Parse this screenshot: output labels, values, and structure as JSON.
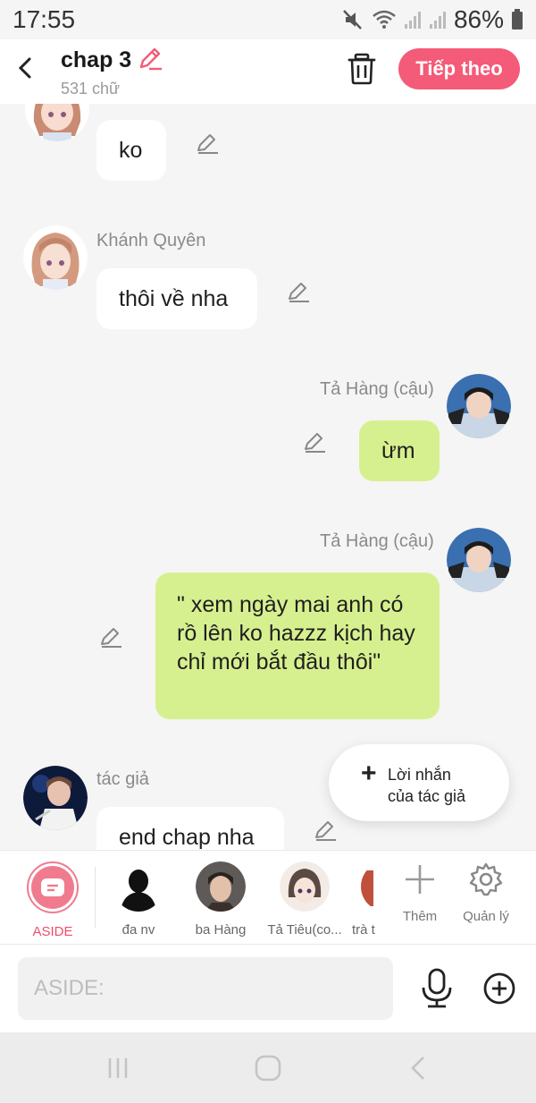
{
  "status_bar": {
    "time": "17:55",
    "battery": "86%"
  },
  "header": {
    "title": "chap 3",
    "subtitle": "531 chữ",
    "next_label": "Tiếp theo"
  },
  "messages": [
    {
      "text": "ko"
    },
    {
      "sender": "Khánh Quyên",
      "text": "thôi về nha"
    },
    {
      "sender": "Tả Hàng (cậu)",
      "text": "ừm"
    },
    {
      "sender": "Tả Hàng (cậu)",
      "text": "\" xem ngày mai anh có rồ lên ko hazzz kịch hay chỉ mới bắt đầu thôi\""
    },
    {
      "sender": "tác giả",
      "text": "end chap nha"
    }
  ],
  "author_note": {
    "line1": "Lời nhắn",
    "line2": "của tác giả"
  },
  "characters": [
    {
      "label": "ASIDE",
      "active": true
    },
    {
      "label": "đa nv"
    },
    {
      "label": "ba Hàng"
    },
    {
      "label": "Tả Tiêu(co..."
    },
    {
      "label": "trà t"
    }
  ],
  "tools": {
    "add_label": "Thêm",
    "manage_label": "Quản lý"
  },
  "input": {
    "placeholder": "ASIDE:"
  },
  "colors": {
    "accent": "#f45b78",
    "green_bubble": "#d7f08f",
    "white_bubble": "#ffffff"
  }
}
